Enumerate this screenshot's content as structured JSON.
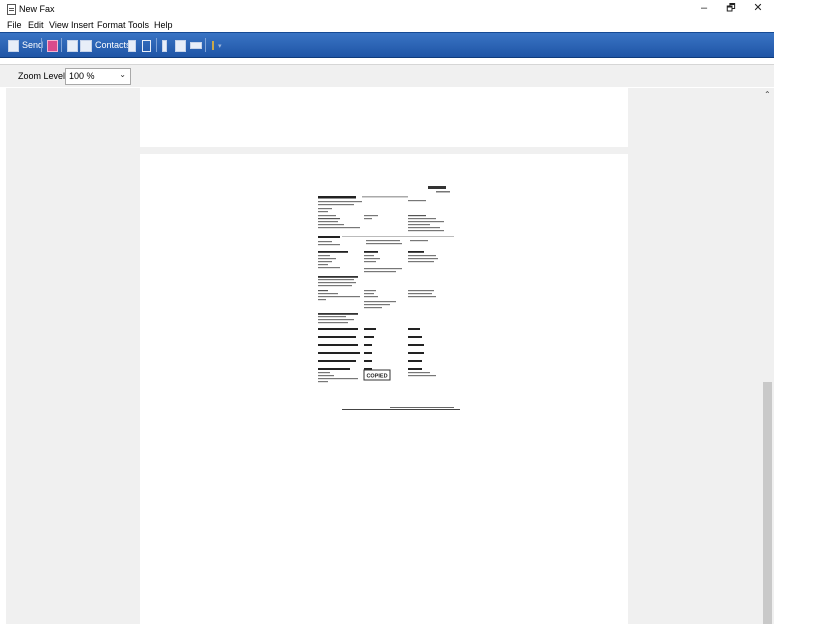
{
  "window": {
    "title": "New Fax",
    "minimize_glyph": "–",
    "restore_glyph": "🗗",
    "close_glyph": "✕"
  },
  "menu": [
    "File",
    "Edit",
    "View",
    "Insert",
    "Format",
    "Tools",
    "Help"
  ],
  "toolbar": {
    "send_label": "Send",
    "contacts_label": "Contacts",
    "icons": [
      "send-icon",
      "save-icon",
      "cover-page-icon",
      "contacts-icon",
      "grid-icon",
      "cut-icon",
      "attach-icon",
      "scan-icon",
      "separator-line-icon",
      "priority-icon"
    ]
  },
  "zoom": {
    "label": "Zoom Level",
    "value": "100 %"
  },
  "fax_page": {
    "stamp_text": "COPIED"
  },
  "colors": {
    "toolbar": "#2a63b4",
    "background": "#f0f0f0",
    "page": "#ffffff"
  }
}
